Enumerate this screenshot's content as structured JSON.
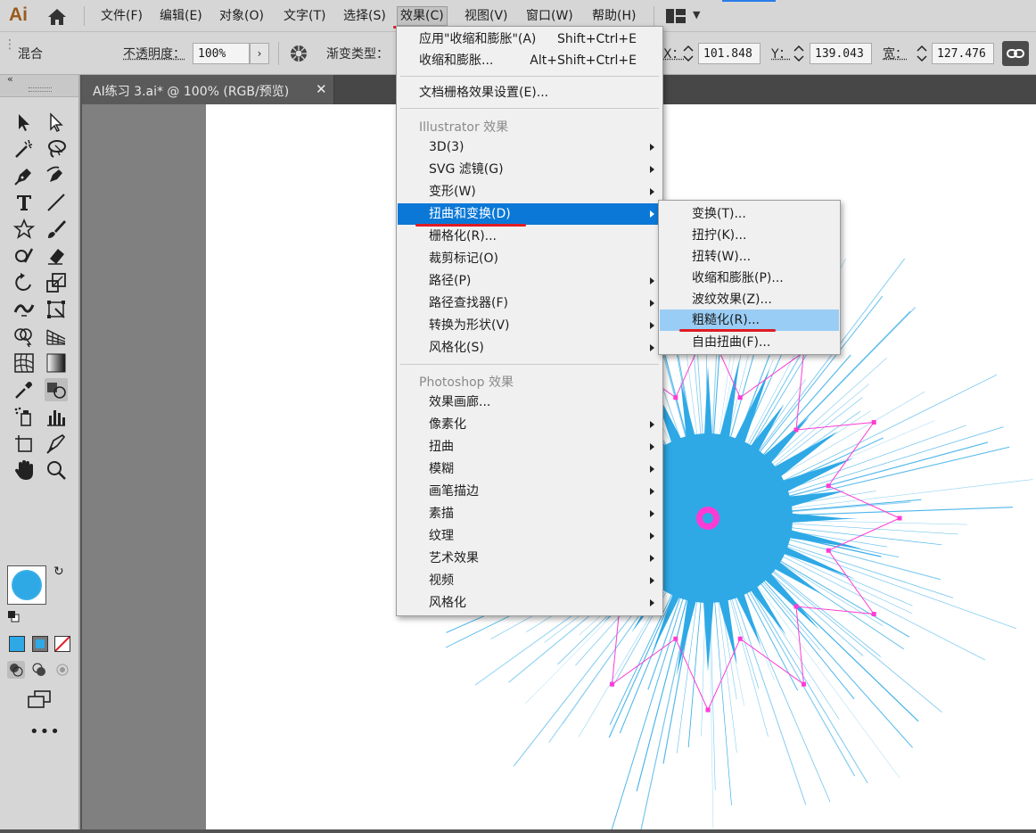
{
  "app": {
    "logo": "Ai"
  },
  "menubar": {
    "items": [
      "文件(F)",
      "编辑(E)",
      "对象(O)",
      "文字(T)",
      "选择(S)",
      "效果(C)",
      "视图(V)",
      "窗口(W)",
      "帮助(H)"
    ],
    "active": "效果(C)"
  },
  "controlbar": {
    "mode_label": "混合",
    "opacity_label": "不透明度：",
    "opacity_value": "100%",
    "gradient_type_label": "渐变类型：",
    "x_label": "X：",
    "x_value": "101.848",
    "y_label": "Y：",
    "y_value": "139.043",
    "w_label": "宽：",
    "w_value": "127.476"
  },
  "document_tab": {
    "label": "AI练习 3.ai* @ 100% (RGB/预览)",
    "close_icon": "close-icon"
  },
  "effect_menu": {
    "apply_last": {
      "label": "应用\"收缩和膨胀\"(A)",
      "shortcut": "Shift+Ctrl+E"
    },
    "last_effect": {
      "label": "收缩和膨胀...",
      "shortcut": "Alt+Shift+Ctrl+E"
    },
    "raster_settings": "文档栅格效果设置(E)...",
    "illustrator_header": "Illustrator 效果",
    "illustrator_items": [
      "3D(3)",
      "SVG 滤镜(G)",
      "变形(W)",
      "扭曲和变换(D)",
      "栅格化(R)...",
      "裁剪标记(O)",
      "路径(P)",
      "路径查找器(F)",
      "转换为形状(V)",
      "风格化(S)"
    ],
    "photoshop_header": "Photoshop 效果",
    "photoshop_items": [
      "效果画廊...",
      "像素化",
      "扭曲",
      "模糊",
      "画笔描边",
      "素描",
      "纹理",
      "艺术效果",
      "视频",
      "风格化"
    ]
  },
  "distort_submenu": {
    "items": [
      "变换(T)...",
      "扭拧(K)...",
      "扭转(W)...",
      "收缩和膨胀(P)...",
      "波纹效果(Z)...",
      "粗糙化(R)...",
      "自由扭曲(F)..."
    ],
    "hovered": "粗糙化(R)..."
  },
  "colors": {
    "menu_highlight": "#0b78d7",
    "submenu_hover": "#9acdf5",
    "artwork_fill": "#2ea9e6",
    "anchor_points": "#ff3bd4",
    "annotation_red": "#e01b24"
  }
}
